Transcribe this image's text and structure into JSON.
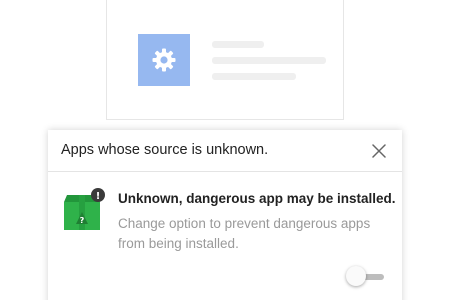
{
  "background_card": {
    "icon": "gear-icon",
    "tile_color": "#96b8f0"
  },
  "dialog": {
    "title": "Apps whose source is unknown.",
    "close_icon": "close-icon",
    "app_icon": "unknown-app-package-icon",
    "warning_badge": "!",
    "package_mark": "?",
    "message_title": "Unknown, dangerous app may be installed.",
    "message_description": "Change option to prevent dangerous apps from being installed.",
    "toggle": {
      "state": "off"
    }
  },
  "colors": {
    "package_green": "#2fb24a",
    "badge": "#3a3a3a",
    "muted_text": "#9a9a9a"
  }
}
